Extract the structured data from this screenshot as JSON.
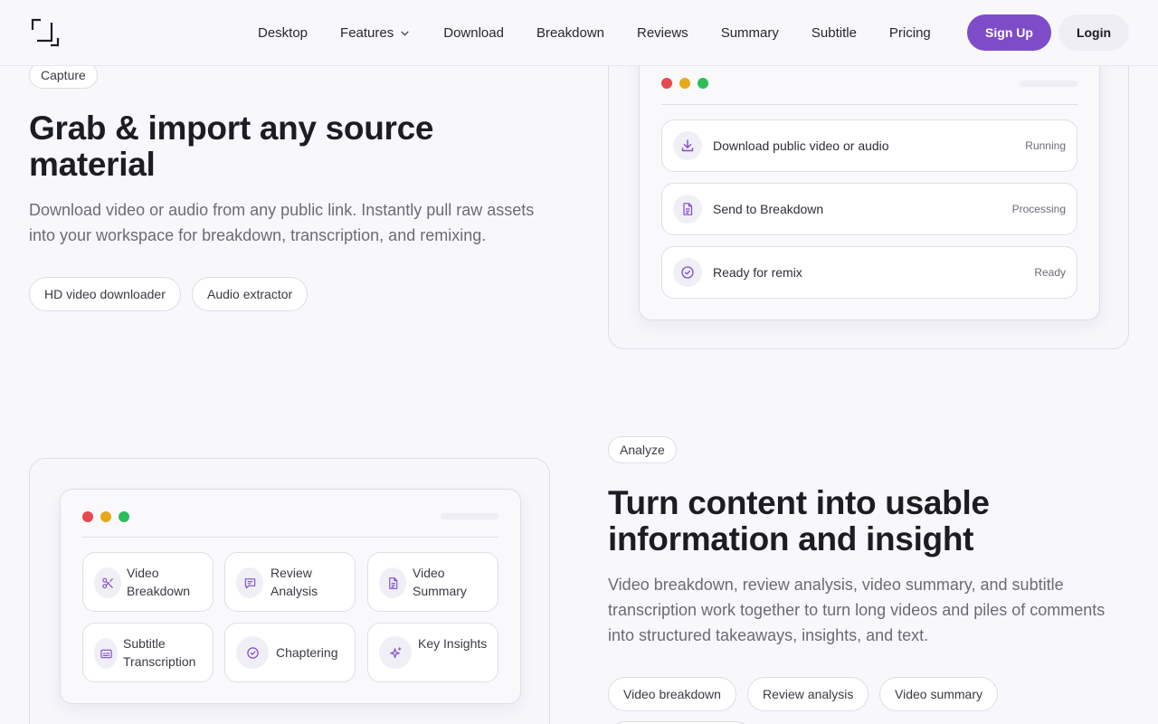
{
  "header": {
    "nav": [
      "Desktop",
      "Features",
      "Download",
      "Breakdown",
      "Reviews",
      "Summary",
      "Subtitle",
      "Pricing"
    ],
    "signup_label": "Sign Up",
    "login_label": "Login"
  },
  "capture": {
    "tag": "Capture",
    "title": "Grab & import any source material",
    "description": "Download video or audio from any public link. Instantly pull raw assets into your workspace for breakdown, transcription, and remixing.",
    "chips": [
      "HD video downloader",
      "Audio extractor"
    ],
    "steps": [
      {
        "label": "Download public video or audio",
        "status": "Running",
        "icon": "download-icon"
      },
      {
        "label": "Send to Breakdown",
        "status": "Processing",
        "icon": "document-icon"
      },
      {
        "label": "Ready for remix",
        "status": "Ready",
        "icon": "check-circle-icon"
      }
    ]
  },
  "analyze": {
    "tag": "Analyze",
    "title": "Turn content into usable information and insight",
    "description": "Video breakdown, review analysis, video summary, and subtitle transcription work together to turn long videos and piles of comments into structured takeaways, insights, and text.",
    "chips": [
      "Video breakdown",
      "Review analysis",
      "Video summary"
    ],
    "cards": [
      {
        "label": "Video Breakdown",
        "icon": "scissors-icon"
      },
      {
        "label": "Review Analysis",
        "icon": "chat-icon"
      },
      {
        "label": "Video Summary",
        "icon": "document-icon"
      },
      {
        "label": "Subtitle Transcription",
        "icon": "subtitle-icon"
      },
      {
        "label": "Chaptering",
        "icon": "check-circle-icon"
      },
      {
        "label": "Key Insights",
        "icon": "sparkle-icon"
      }
    ]
  },
  "colors": {
    "accent": "#7e4cc9",
    "traffic_red": "#e5484d",
    "traffic_yellow": "#e5a91b",
    "traffic_green": "#2fbd5a"
  }
}
